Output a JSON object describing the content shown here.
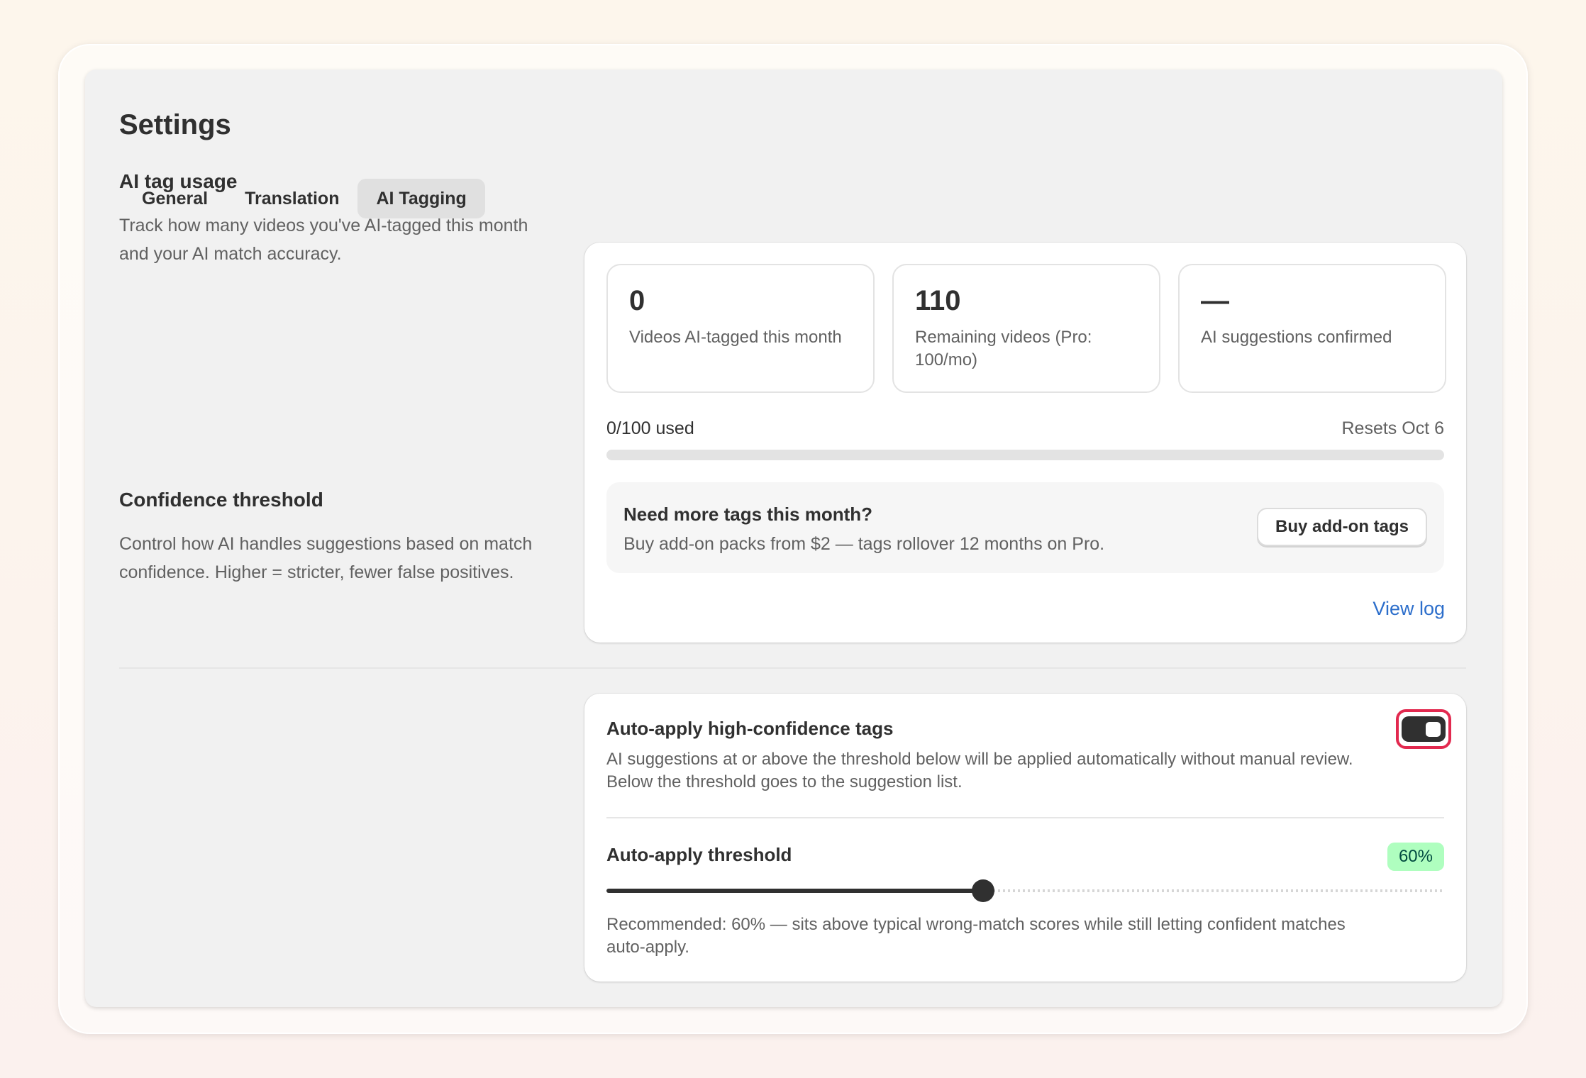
{
  "page": {
    "title": "Settings"
  },
  "tabs": [
    {
      "label": "General",
      "active": false
    },
    {
      "label": "Translation",
      "active": false
    },
    {
      "label": "AI Tagging",
      "active": true
    }
  ],
  "usage_section": {
    "heading": "AI tag usage",
    "description": "Track how many videos you've AI-tagged this month and your AI match accuracy.",
    "stats": [
      {
        "value": "0",
        "label": "Videos AI-tagged this month"
      },
      {
        "value": "110",
        "label": "Remaining videos (Pro: 100/mo)"
      },
      {
        "value": "—",
        "label": "AI suggestions confirmed"
      }
    ],
    "usage_text": "0/100 used",
    "reset_text": "Resets Oct 6",
    "usage_fraction": 0,
    "upsell": {
      "title": "Need more tags this month?",
      "subtitle": "Buy add-on packs from $2 — tags rollover 12 months on Pro.",
      "button_label": "Buy add-on tags"
    },
    "view_log_label": "View log"
  },
  "confidence_section": {
    "heading": "Confidence threshold",
    "description": "Control how AI handles suggestions based on match confidence. Higher = stricter, fewer false positives.",
    "auto_apply": {
      "title": "Auto-apply high-confidence tags",
      "description": "AI suggestions at or above the threshold below will be applied automatically without manual review. Below the threshold goes to the suggestion list.",
      "enabled": true
    },
    "threshold": {
      "title": "Auto-apply threshold",
      "badge": "60%",
      "value_percent": 45,
      "help": "Recommended: 60% — sits above typical wrong-match scores while still letting confident matches auto-apply."
    }
  },
  "colors": {
    "accent_dark": "#303030",
    "link_blue": "#2c6ecb",
    "badge_green": "#affebf",
    "focus_ring": "#e2294f"
  }
}
